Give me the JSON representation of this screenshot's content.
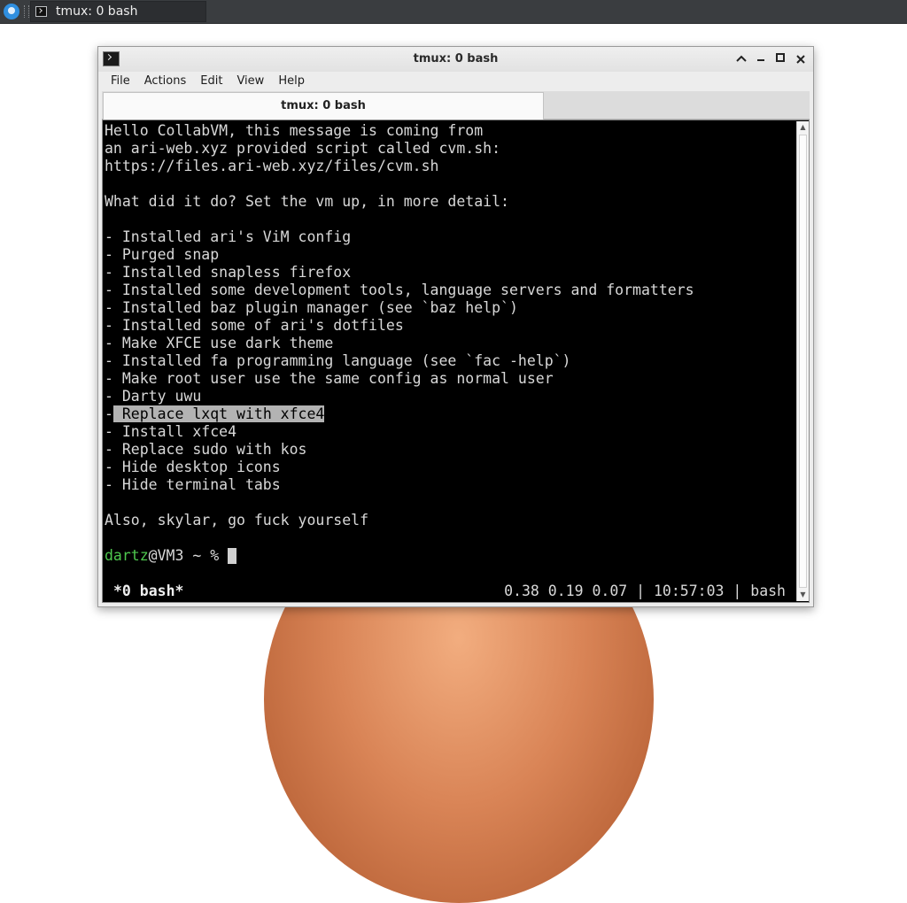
{
  "panel": {
    "task_title": "tmux: 0 bash",
    "menu_icon": "xfce-whisker-menu-icon",
    "task_icon": "terminal-icon"
  },
  "window": {
    "title": "tmux: 0 bash",
    "icon": "terminal-icon",
    "controls": {
      "shade": "▲",
      "minimize": "▬",
      "maximize": "■",
      "close": "✕"
    }
  },
  "menubar": {
    "items": [
      "File",
      "Actions",
      "Edit",
      "View",
      "Help"
    ]
  },
  "tabs": [
    {
      "label": "tmux: 0 bash",
      "active": true
    }
  ],
  "terminal": {
    "lines": [
      "Hello CollabVM, this message is coming from",
      "an ari-web.xyz provided script called cvm.sh:",
      "https://files.ari-web.xyz/files/cvm.sh",
      "",
      "What did it do? Set the vm up, in more detail:",
      "",
      "- Installed ari's ViM config",
      "- Purged snap",
      "- Installed snapless firefox",
      "- Installed some development tools, language servers and formatters",
      "- Installed baz plugin manager (see `baz help`)",
      "- Installed some of ari's dotfiles",
      "- Make XFCE use dark theme",
      "- Installed fa programming language (see `fac -help`)",
      "- Make root user use the same config as normal user",
      "- Darty uwu",
      "- Replace lxqt with xfce4",
      "- Install xfce4",
      "- Replace sudo with kos",
      "- Hide desktop icons",
      "- Hide terminal tabs",
      "",
      "Also, skylar, go fuck yourself",
      ""
    ],
    "highlighted_line": {
      "prefix": "-",
      "text": " Replace lxqt with xfce4"
    },
    "prompt": {
      "user": "dartz",
      "host_path": "@VM3 ~ % "
    },
    "status_left": "*0 bash*",
    "status_right": "0.38 0.19 0.07 | 10:57:03 | bash",
    "text_color": "#d8d8d8",
    "user_color": "#4ec84e",
    "selection_color": "#b3b3b3"
  }
}
